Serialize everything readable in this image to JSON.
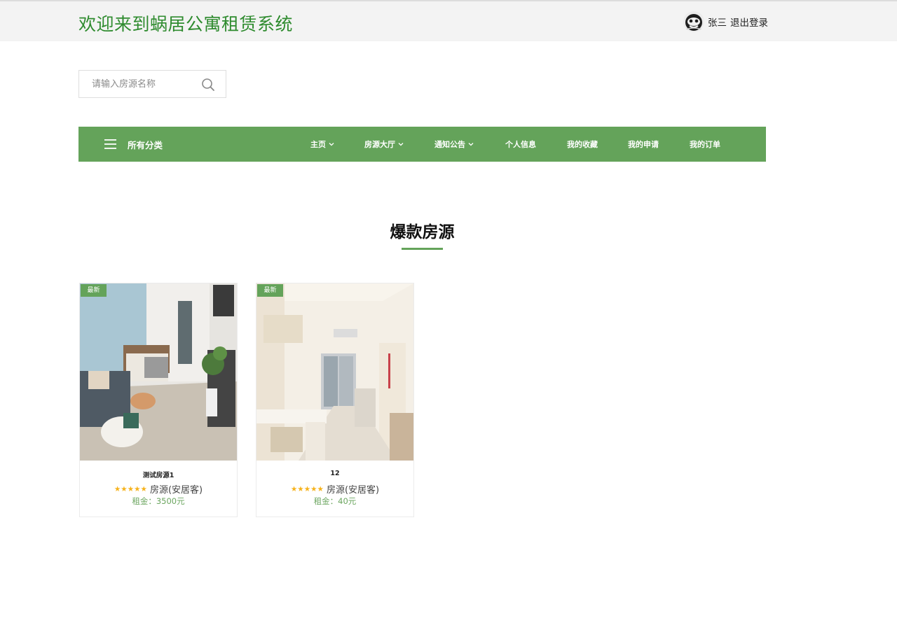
{
  "header": {
    "title": "欢迎来到蜗居公寓租赁系统",
    "user_name": "张三",
    "logout_label": "退出登录"
  },
  "search": {
    "placeholder": "请输入房源名称",
    "value": ""
  },
  "nav": {
    "all_categories": "所有分类",
    "items": [
      {
        "label": "主页",
        "has_dropdown": true
      },
      {
        "label": "房源大厅",
        "has_dropdown": true
      },
      {
        "label": "通知公告",
        "has_dropdown": true
      },
      {
        "label": "个人信息",
        "has_dropdown": false
      },
      {
        "label": "我的收藏",
        "has_dropdown": false
      },
      {
        "label": "我的申请",
        "has_dropdown": false
      },
      {
        "label": "我的订单",
        "has_dropdown": false
      }
    ]
  },
  "section": {
    "title": "爆款房源"
  },
  "listings": [
    {
      "badge": "最新",
      "name": "测试房源1",
      "rating": 5,
      "type": "房源(安居客)",
      "price": "租金：3500元"
    },
    {
      "badge": "最新",
      "name": "12",
      "rating": 5,
      "type": "房源(安居客)",
      "price": "租金：40元"
    }
  ],
  "colors": {
    "accent": "#64a35a",
    "title_green": "#2e8b2e",
    "price_green": "#6aa55e",
    "star": "#f6b21b",
    "topbar_bg": "#f3f3f3"
  },
  "icons": {
    "search": "search-icon",
    "menu": "hamburger-icon",
    "dropdown": "chevron-down-icon",
    "avatar": "avatar-icon"
  }
}
